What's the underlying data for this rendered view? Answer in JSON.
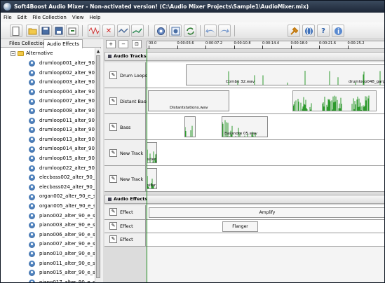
{
  "window": {
    "title": "Soft4Boost Audio Mixer - Non-activated version! (C:\\Audio Mixer Projects\\Sample1\\AudioMixer.mix)"
  },
  "menu": [
    "File",
    "Edit",
    "File Collection",
    "View",
    "Help"
  ],
  "toolbar": {
    "buttons": [
      "new-project",
      "open",
      "save",
      "save-as",
      "import",
      "export",
      "mixdown",
      "delete",
      "cut",
      "copy",
      "properties",
      "settings",
      "refresh",
      "undo",
      "redo",
      "tools",
      "web",
      "help",
      "about"
    ]
  },
  "left_panel": {
    "tabs": [
      "Files Collection",
      "Audio Effects"
    ],
    "active_tab": "Audio Effects",
    "tree_root": "Alternative",
    "files": [
      "drumloop001_alter_90_x_",
      "drumloop002_alter_90_x_",
      "drumloop003_alter_90_x_",
      "drumloop004_alter_90_x_",
      "drumloop007_alter_90_x_",
      "drumloop008_alter_90_x_",
      "drumloop011_alter_90_x_",
      "drumloop013_alter_90_x_",
      "drumloop013_alter_90_x_",
      "drumloop014_alter_90_x_",
      "drumloop015_alter_90_x_",
      "drumloop022_alter_90_x_",
      "elecbass002_alter_90_e_",
      "elecbass024_alter_90_e_",
      "organ002_alter_90_e_sc",
      "organ005_alter_90_e_sc",
      "piano002_alter_90_e_sc4",
      "piano003_alter_90_e_sc4",
      "piano006_alter_90_e_sc4",
      "piano007_alter_90_e_sc4",
      "piano010_alter_90_e_sc4",
      "piano011_alter_90_e_sc4",
      "piano015_alter_90_e_sc4",
      "piano017_alter_90_e_sc4"
    ]
  },
  "timeline": {
    "ruler_ticks": [
      "00.0",
      "0:00:03.6",
      "0:00:07.2",
      "0:00:10.8",
      "0:00:14.4",
      "0:00:18.0",
      "0:00:21.6",
      "0:00:25.2"
    ],
    "audio_tracks_label": "Audio Tracks",
    "audio_effects_label": "Audio Effects",
    "tracks": [
      {
        "name": "Drum Loops",
        "clips": [
          "Combo 32.wav",
          "drumloop048_garga"
        ]
      },
      {
        "name": "Distant Bass",
        "clips": [
          "Distantstations.wav"
        ]
      },
      {
        "name": "Bass",
        "clips": [
          "Bassnote 05.wav"
        ]
      },
      {
        "name": "New Track",
        "clips": [
          "siter_"
        ]
      },
      {
        "name": "New Track",
        "clips": [
          "siter_"
        ]
      }
    ],
    "effects": [
      {
        "name": "Effect",
        "block": "Amplify"
      },
      {
        "name": "Effect",
        "block": "Flanger"
      },
      {
        "name": "Effect",
        "block": ""
      }
    ]
  },
  "colors": {
    "wave": "#2e9a2e",
    "cursor": "#1e8c1e",
    "titlebar": "#1d2737"
  }
}
